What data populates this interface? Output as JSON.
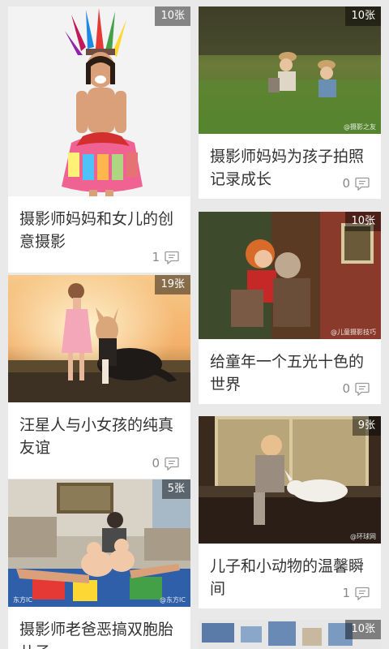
{
  "cards": [
    {
      "badge": "10张",
      "title": "摄影师妈妈和女儿的创意摄影",
      "comments": "1",
      "watermark": ""
    },
    {
      "badge": "10张",
      "title": "摄影师妈妈为孩子拍照记录成长",
      "comments": "0",
      "watermark": "@摄影之友"
    },
    {
      "badge": "19张",
      "title": "汪星人与小女孩的纯真友谊",
      "comments": "0",
      "watermark": ""
    },
    {
      "badge": "10张",
      "title": "给童年一个五光十色的世界",
      "comments": "0",
      "watermark": "@儿童摄影技巧"
    },
    {
      "badge": "5张",
      "title": "摄影师老爸恶搞双胞胎儿子",
      "comments": "",
      "watermark": "@东方IC",
      "watermark_left": "东方IC"
    },
    {
      "badge": "9张",
      "title": "儿子和小动物的温馨瞬间",
      "comments": "1",
      "watermark": "@环球网"
    },
    {
      "badge": "10张",
      "title": "",
      "comments": "",
      "watermark": ""
    }
  ],
  "colors": {
    "background": "#e9e9e9",
    "card": "#ffffff",
    "title": "#333333",
    "meta": "#888888",
    "badge_bg": "rgba(0,0,0,0.45)"
  },
  "icons": {
    "comment": "comment-bubble-icon"
  }
}
